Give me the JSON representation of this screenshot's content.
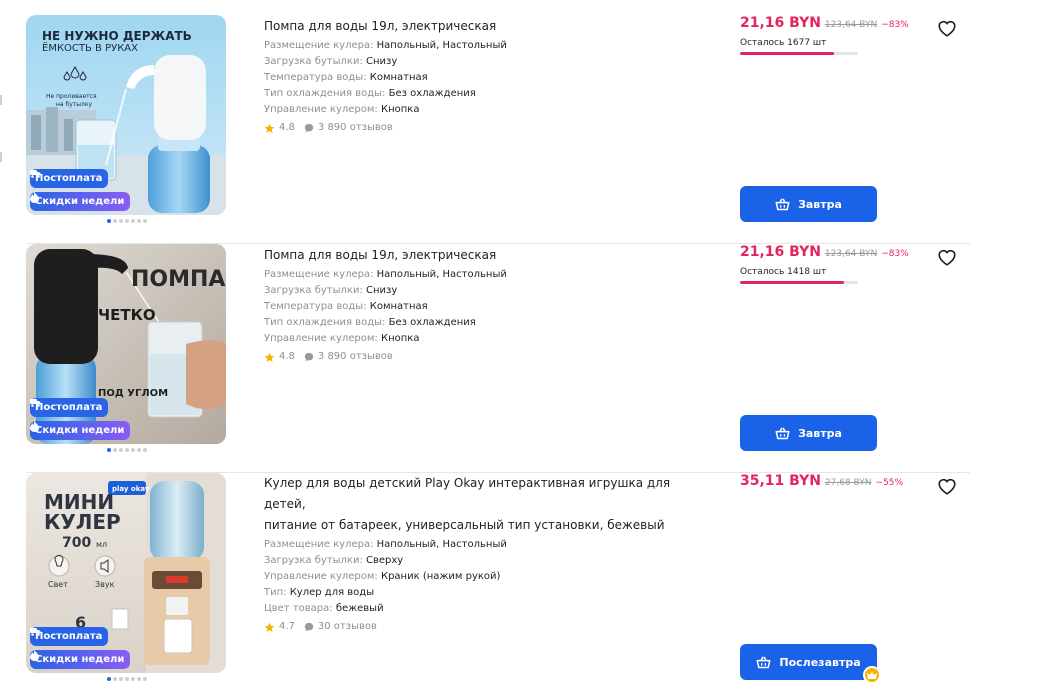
{
  "products": [
    {
      "title": "Помпа для воды 19л, электрическая",
      "photo_text": {
        "line1": "НЕ НУЖНО ДЕРЖАТЬ",
        "line2": "ЁМКОСТЬ В РУКАХ",
        "line3": "Не проливается",
        "line4": "на бутылку"
      },
      "badges": {
        "postpay": "Постоплата",
        "sale": "Скидки недели"
      },
      "specs": [
        {
          "key": "Размещение кулера:",
          "value": "Напольный, Настольный"
        },
        {
          "key": "Загрузка бутылки:",
          "value": "Снизу"
        },
        {
          "key": "Температура воды:",
          "value": "Комнатная"
        },
        {
          "key": "Тип охлаждения воды:",
          "value": "Без охлаждения"
        },
        {
          "key": "Управление кулером:",
          "value": "Кнопка"
        }
      ],
      "rating": "4.8",
      "reviews": "3 890 отзывов",
      "price": "21,16 BYN",
      "old_price": "123,64 BYN",
      "discount": "−83%",
      "stock": "Осталось 1677 шт",
      "stock_level": 0.8,
      "button": "Завтра"
    },
    {
      "title": "Помпа для воды 19л, электрическая",
      "photo_text": {
        "line1": "ПОМПА",
        "line2": "ЧЕТКО",
        "line3": "ПОД УГЛОМ"
      },
      "badges": {
        "postpay": "Постоплата",
        "sale": "Скидки недели"
      },
      "specs": [
        {
          "key": "Размещение кулера:",
          "value": "Напольный, Настольный"
        },
        {
          "key": "Загрузка бутылки:",
          "value": "Снизу"
        },
        {
          "key": "Температура воды:",
          "value": "Комнатная"
        },
        {
          "key": "Тип охлаждения воды:",
          "value": "Без охлаждения"
        },
        {
          "key": "Управление кулером:",
          "value": "Кнопка"
        }
      ],
      "rating": "4.8",
      "reviews": "3 890 отзывов",
      "price": "21,16 BYN",
      "old_price": "123,64 BYN",
      "discount": "−83%",
      "stock": "Осталось 1418 шт",
      "stock_level": 0.88,
      "button": "Завтра"
    },
    {
      "title_line1": "Кулер для воды детский Play Okay интерактивная игрушка для детей,",
      "title_line2": "питание от батареек, универсальный тип установки, бежевый",
      "photo_text": {
        "brand": "play okay",
        "line1": "МИНИ",
        "line2": "КУЛЕР",
        "line3": "700",
        "unit": "мл",
        "light": "Свет",
        "sound": "Звук",
        "cups": "6"
      },
      "badges": {
        "postpay": "Постоплата",
        "sale": "Скидки недели"
      },
      "specs": [
        {
          "key": "Размещение кулера:",
          "value": "Напольный, Настольный"
        },
        {
          "key": "Загрузка бутылки:",
          "value": "Сверху"
        },
        {
          "key": "Управление кулером:",
          "value": "Краник (нажим рукой)"
        },
        {
          "key": "Тип:",
          "value": "Кулер для воды"
        },
        {
          "key": "Цвет товара:",
          "value": "бежевый"
        }
      ],
      "rating": "4.7",
      "reviews": "30 отзывов",
      "price": "35,11 BYN",
      "old_price": "27,68 BYN",
      "discount": "−55%",
      "button": "Послезавтра"
    }
  ],
  "colors": {
    "accent": "#1a63e8",
    "price": "#e5245b",
    "star": "#f6b400"
  }
}
